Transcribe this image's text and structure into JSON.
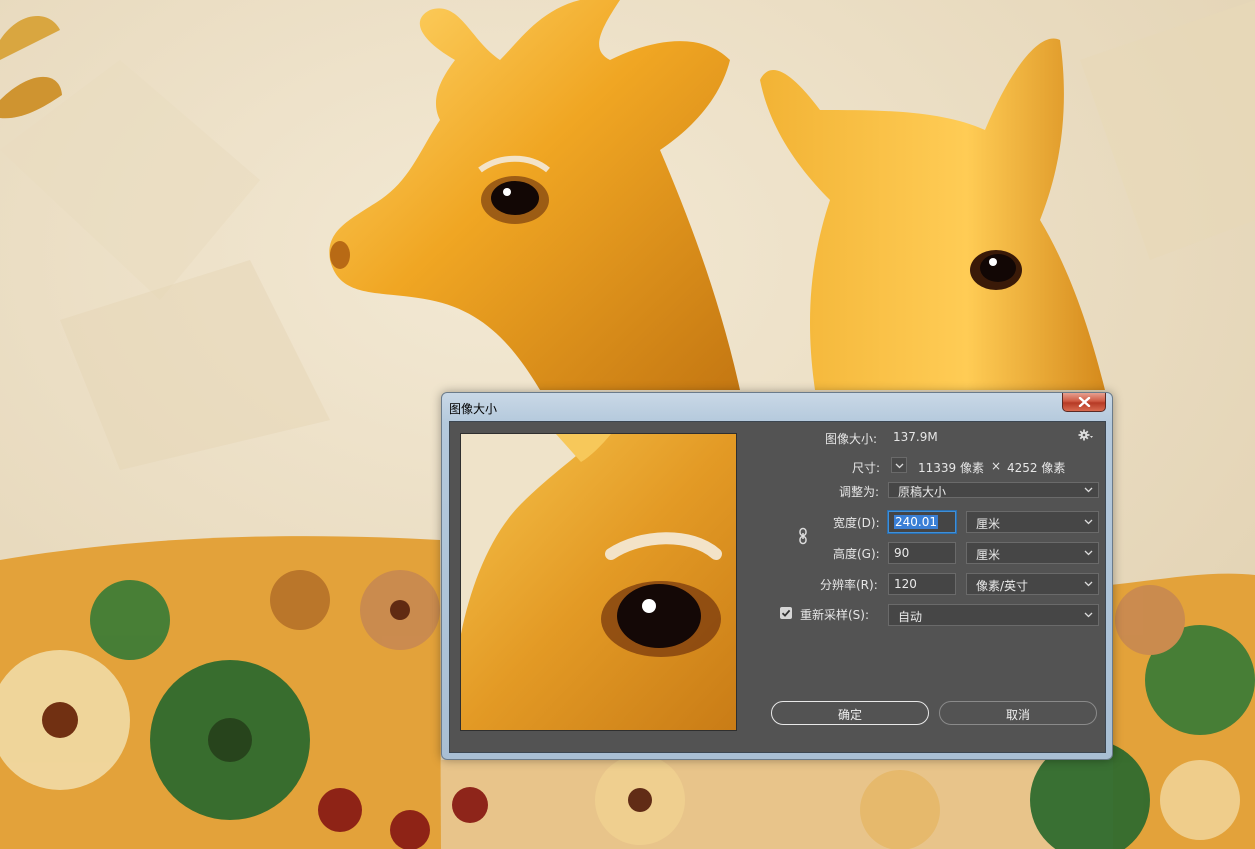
{
  "dialog": {
    "title": "图像大小",
    "image_size_label": "图像大小:",
    "image_size_value": "137.9M",
    "dimensions_label": "尺寸:",
    "dimensions_width": "11339 像素",
    "dimensions_sep": "×",
    "dimensions_height": "4252 像素",
    "fit_to_label": "调整为:",
    "fit_to_value": "原稿大小",
    "width_label": "宽度(D):",
    "width_value": "240.01",
    "width_unit": "厘米",
    "height_label": "高度(G):",
    "height_value": "90",
    "height_unit": "厘米",
    "resolution_label": "分辨率(R):",
    "resolution_value": "120",
    "resolution_unit": "像素/英寸",
    "resample_checked": true,
    "resample_label": "重新采样(S):",
    "resample_value": "自动",
    "ok_label": "确定",
    "cancel_label": "取消"
  },
  "colors": {
    "dialog_client": "#535353",
    "selection": "#3a7fd5",
    "close_button": "#c8452e"
  }
}
